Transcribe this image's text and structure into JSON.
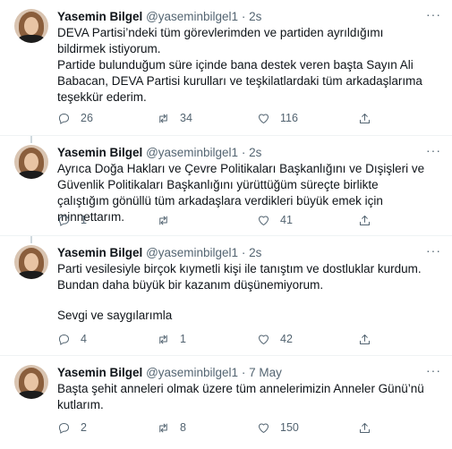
{
  "tweets": [
    {
      "name": "Yasemin Bilgel",
      "handle": "@yaseminbilgel1",
      "dot": "·",
      "time": "2s",
      "more": "···",
      "paragraphs": [
        "DEVA Partisi’ndeki tüm görevlerimden ve partiden ayrıldığımı bildirmek istiyorum.",
        "Partide bulunduğum süre içinde bana destek veren başta Sayın Ali Babacan, DEVA Partisi kurulları ve teşkilatlardaki tüm arkadaşlarıma teşekkür ederim."
      ],
      "replies": "26",
      "retweets": "34",
      "likes": "116"
    },
    {
      "name": "Yasemin Bilgel",
      "handle": "@yaseminbilgel1",
      "dot": "·",
      "time": "2s",
      "more": "···",
      "paragraphs": [
        "Ayrıca Doğa Hakları ve Çevre Politikaları Başkanlığını ve Dışişleri ve Güvenlik Politikaları Başkanlığını yürüttüğüm süreçte birlikte çalıştığım gönüllü tüm arkadaşlara verdikleri büyük emek için minnettarım."
      ],
      "replies": "1",
      "retweets": "",
      "likes": "41"
    },
    {
      "name": "Yasemin Bilgel",
      "handle": "@yaseminbilgel1",
      "dot": "·",
      "time": "2s",
      "more": "···",
      "paragraphs": [
        "Parti vesilesiyle birçok kıymetli kişi ile tanıştım ve dostluklar kurdum. Bundan daha büyük bir kazanım düşünemiyorum.",
        "",
        "Sevgi ve saygılarımla"
      ],
      "replies": "4",
      "retweets": "1",
      "likes": "42"
    },
    {
      "name": "Yasemin Bilgel",
      "handle": "@yaseminbilgel1",
      "dot": "·",
      "time": "7 May",
      "more": "···",
      "paragraphs": [
        "Başta şehit anneleri olmak üzere tüm annelerimizin Anneler Günü’nü kutlarım."
      ],
      "replies": "2",
      "retweets": "8",
      "likes": "150"
    }
  ],
  "icons": {
    "reply": "reply-icon",
    "retweet": "retweet-icon",
    "like": "heart-icon",
    "share": "share-icon",
    "more": "more-options-icon"
  },
  "colors": {
    "text": "#0f1419",
    "secondary": "#536471",
    "divider": "#eff3f4",
    "thread_line": "#cfd9de"
  }
}
